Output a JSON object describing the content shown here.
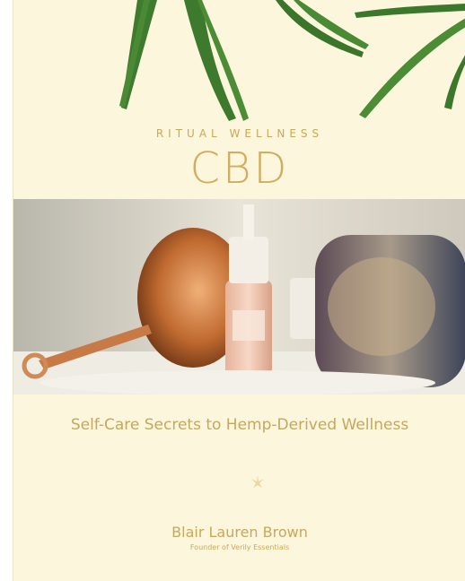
{
  "book": {
    "kicker": "RITUAL WELLNESS",
    "title": "CBD",
    "subtitle": "Self-Care Secrets to Hemp-Derived Wellness",
    "author": "Blair Lauren Brown",
    "author_role": "Founder of Verily Essentials"
  },
  "colors": {
    "cover_background": "#fbf6dc",
    "gold_text": "#c9a85b",
    "leaf_green": "#3f7a2e"
  },
  "icons": {
    "ornament": "leaf-ornament-icon",
    "hemp_leaves": "hemp-leaf-icon"
  }
}
